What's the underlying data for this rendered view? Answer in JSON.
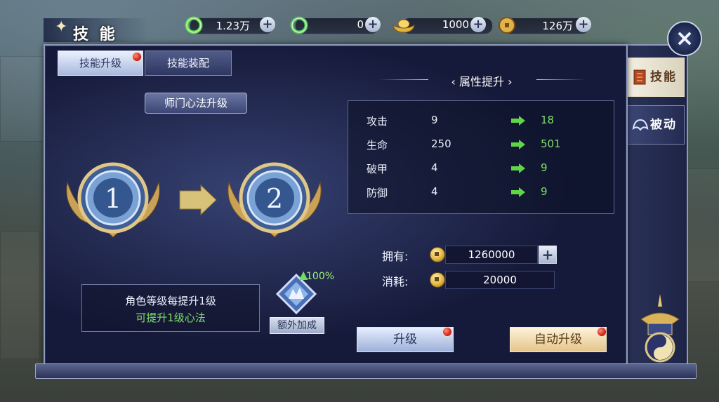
{
  "header": {
    "title": "技 能",
    "currencies": [
      {
        "icon": "jade-ring-icon",
        "value": "1.23万"
      },
      {
        "icon": "green-ring-icon",
        "value": "0"
      },
      {
        "icon": "gold-ingot-icon",
        "value": "1000"
      },
      {
        "icon": "copper-coin-icon",
        "value": "126万"
      }
    ],
    "close_label": "×"
  },
  "tabs": {
    "upgrade_label": "技能升级",
    "equip_label": "技能装配"
  },
  "section_label": "师门心法升级",
  "levels": {
    "current": "1",
    "next": "2"
  },
  "info": {
    "line1": "角色等级每提升1级",
    "line2": "可提升1级心法"
  },
  "bonus": {
    "percent": "100%",
    "label": "额外加成"
  },
  "attributes": {
    "title": "属性提升",
    "rows": [
      {
        "name": "攻击",
        "current": "9",
        "next": "18"
      },
      {
        "name": "生命",
        "current": "250",
        "next": "501"
      },
      {
        "name": "破甲",
        "current": "4",
        "next": "9"
      },
      {
        "name": "防御",
        "current": "4",
        "next": "9"
      }
    ]
  },
  "resources": {
    "owned_label": "拥有:",
    "owned_value": "1260000",
    "cost_label": "消耗:",
    "cost_value": "20000"
  },
  "buttons": {
    "upgrade_label": "升级",
    "auto_label": "自动升级"
  },
  "side_tabs": {
    "skill_label": "技能",
    "passive_label": "被动"
  },
  "colors": {
    "panel_bg": "#1b2044",
    "increase_green": "#7fe06b",
    "accent_gold": "#e2b540",
    "alert_red": "#d2261d"
  }
}
